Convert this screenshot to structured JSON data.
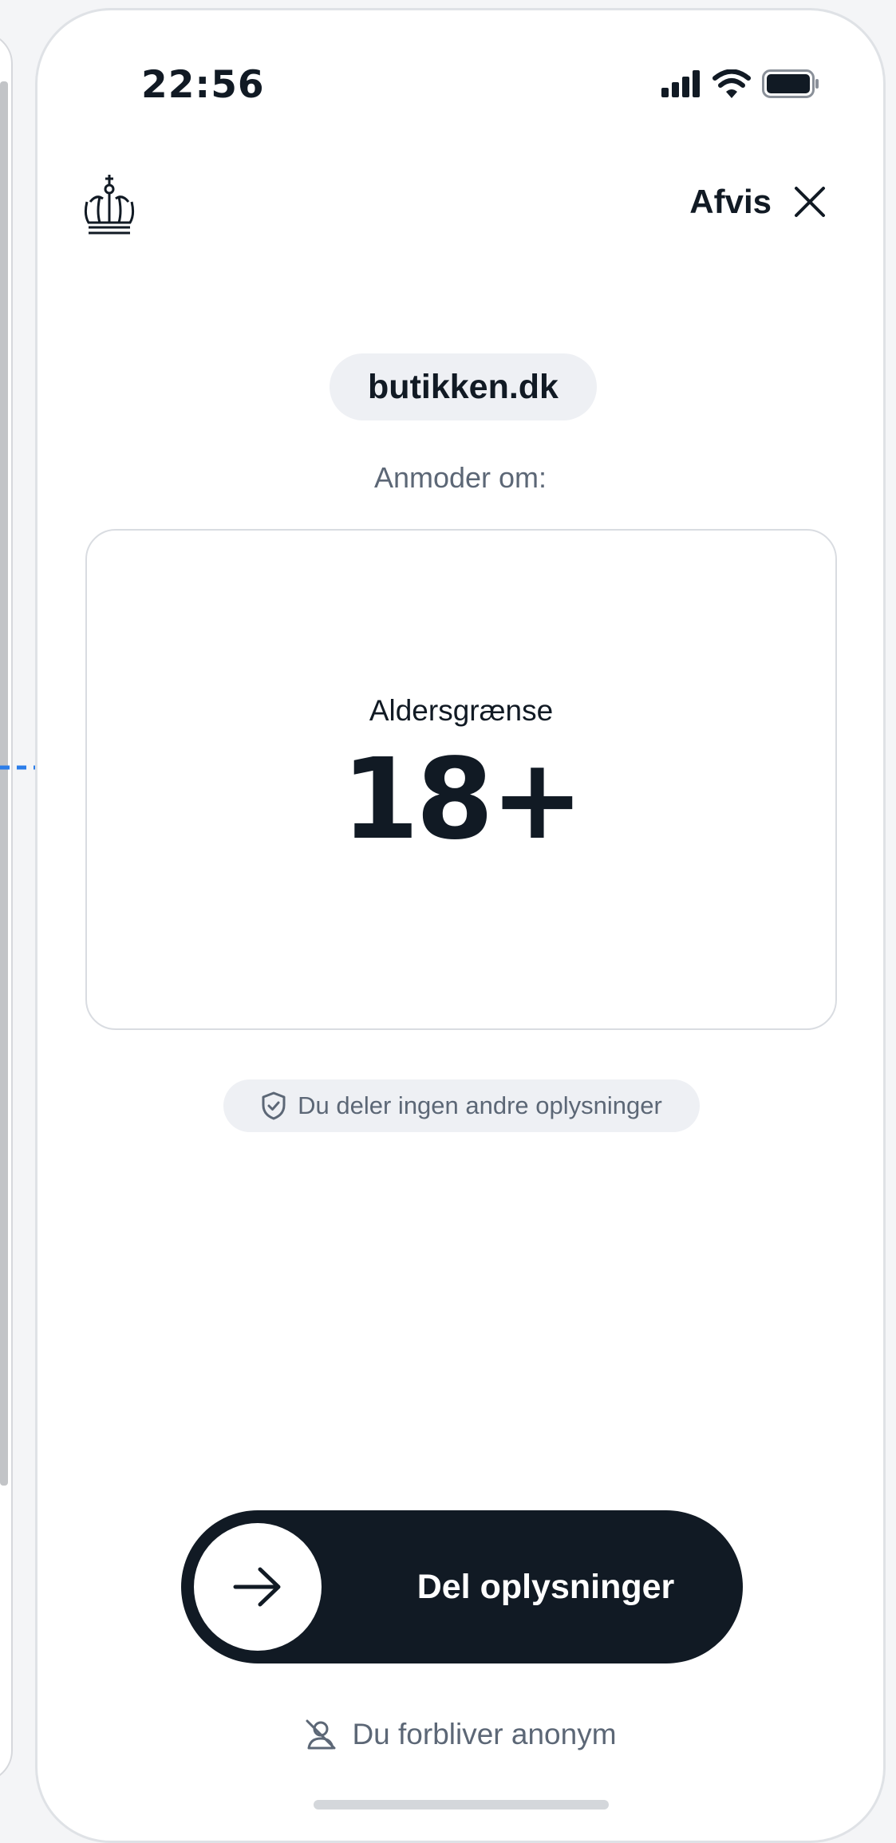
{
  "status_bar": {
    "time": "22:56",
    "icons": [
      "cellular-signal-icon",
      "wifi-icon",
      "battery-icon"
    ]
  },
  "header": {
    "logo": "royal-crown-icon",
    "reject_label": "Afvis",
    "close_icon": "close-icon"
  },
  "request": {
    "domain": "butikken.dk",
    "requesting_label": "Anmoder om:",
    "attribute_label": "Aldersgrænse",
    "attribute_value": "18+"
  },
  "privacy_note": {
    "icon": "shield-check-icon",
    "text": "Du deler ingen andre oplysninger"
  },
  "action": {
    "share_label": "Del oplysninger",
    "knob_icon": "arrow-right-icon"
  },
  "footer": {
    "anonymous_icon": "user-slash-icon",
    "anonymous_text": "Du forbliver anonym"
  },
  "colors": {
    "primary_dark": "#111a24",
    "muted_text": "#5c6776",
    "pill_bg": "#eef0f4",
    "connector_blue": "#2b7de9"
  }
}
